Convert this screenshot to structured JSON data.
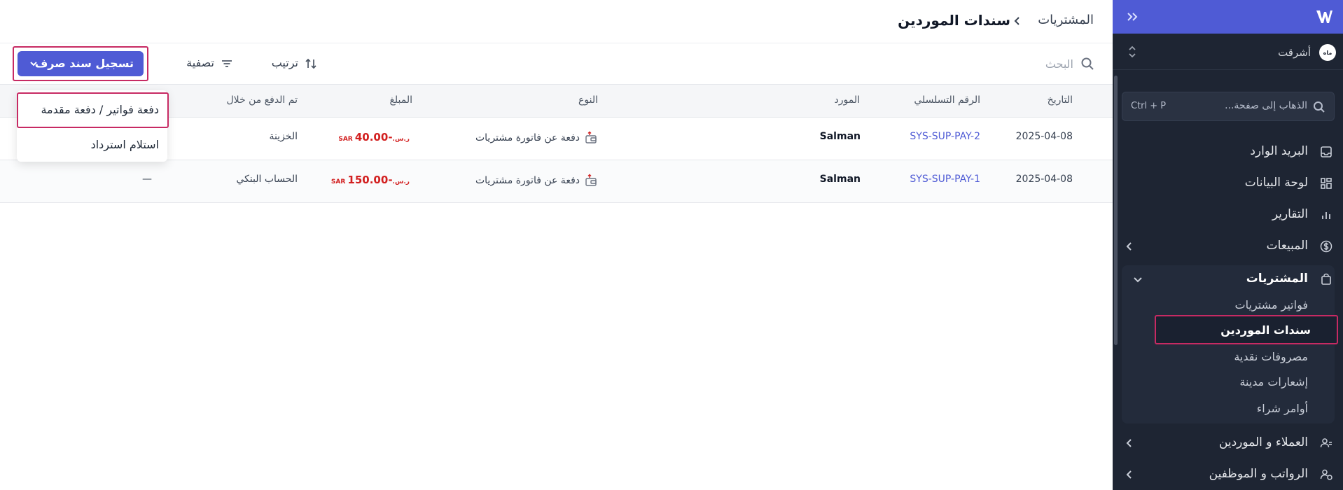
{
  "sidebar": {
    "org_name": "أشرقت",
    "org_avatar_text": "ماه",
    "search_placeholder": "الذهاب إلى صفحة...",
    "search_shortcut": "Ctrl + P",
    "nav": {
      "inbox": "البريد الوارد",
      "dashboard": "لوحة البيانات",
      "reports": "التقارير",
      "sales": "المبيعات",
      "purchases": "المشتريات",
      "contacts": "العملاء و الموردين",
      "payroll": "الرواتب و الموظفين"
    },
    "purchases_sub": [
      "فواتير مشتريات",
      "سندات الموردين",
      "مصروفات نقدية",
      "إشعارات مدينة",
      "أوامر شراء"
    ]
  },
  "header": {
    "breadcrumb_parent": "المشتريات",
    "title": "سندات الموردين"
  },
  "toolbar": {
    "search_placeholder": "البحث",
    "sort_label": "ترتيب",
    "filter_label": "تصفية",
    "primary_button": "تسجيل سند صرف"
  },
  "dropdown": {
    "items": [
      "دفعة فواتير / دفعة مقدمة",
      "استلام استرداد"
    ]
  },
  "table": {
    "columns": {
      "date": "التاريخ",
      "serial": "الرقم التسلسلي",
      "supplier": "المورد",
      "type": "النوع",
      "amount": "المبلغ",
      "paid_via": "تم الدفع من خلال"
    },
    "rows": [
      {
        "date": "2025-04-08",
        "serial": "SYS-SUP-PAY-2",
        "supplier": "Salman",
        "type": "دفعة عن فاتورة مشتريات",
        "amount": "-40.00",
        "currency": "SAR ر.س.",
        "paid_via": "الخزينة",
        "extra": ""
      },
      {
        "date": "2025-04-08",
        "serial": "SYS-SUP-PAY-1",
        "supplier": "Salman",
        "type": "دفعة عن فاتورة مشتريات",
        "amount": "-150.00",
        "currency": "SAR ر.س.",
        "paid_via": "الحساب البنكي",
        "extra": "—"
      }
    ]
  },
  "colors": {
    "brand": "#4f5bd5",
    "sidebar_bg": "#1e2533",
    "highlight": "#c72a63",
    "amount_negative": "#d21f1f"
  }
}
